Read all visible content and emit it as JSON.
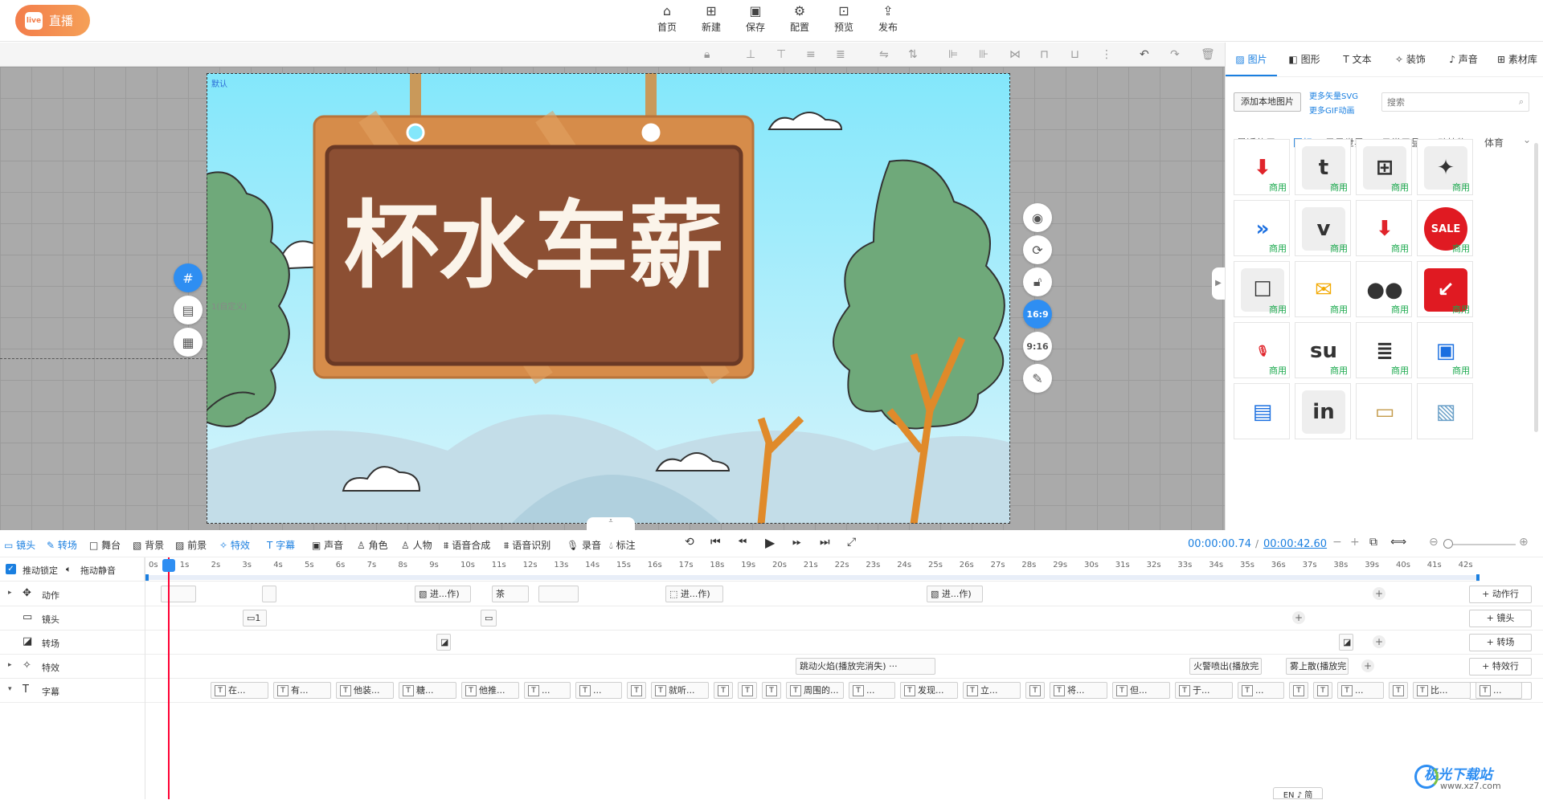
{
  "topbar": {
    "live_label": "直播",
    "live_icon": "live",
    "nav": [
      {
        "label": "首页",
        "icon": "home-icon"
      },
      {
        "label": "新建",
        "icon": "new-icon"
      },
      {
        "label": "保存",
        "icon": "save-icon"
      },
      {
        "label": "配置",
        "icon": "settings-icon"
      },
      {
        "label": "预览",
        "icon": "preview-icon"
      },
      {
        "label": "发布",
        "icon": "publish-icon"
      }
    ]
  },
  "scene": {
    "default_label": "默认",
    "custom_label": "1(自定义)",
    "title_text": "杯水车薪"
  },
  "side_controls": {
    "ratio_169": "16:9",
    "ratio_916": "9:16"
  },
  "right_panel": {
    "tabs": [
      {
        "label": "图片",
        "icon": "image-icon"
      },
      {
        "label": "图形",
        "icon": "shape-icon"
      },
      {
        "label": "文本",
        "icon": "text-icon"
      },
      {
        "label": "装饰",
        "icon": "decor-icon"
      },
      {
        "label": "声音",
        "icon": "sound-icon"
      },
      {
        "label": "素材库",
        "icon": "library-icon"
      }
    ],
    "add_local": "添加本地图片",
    "more_svg": "更多矢量SVG",
    "more_gif": "更多GIF动画",
    "search_placeholder": "搜索",
    "categories": [
      "最近使用",
      "图标",
      "风景世界",
      "日常用品",
      "动植物",
      "体育"
    ],
    "commercial": "商用",
    "tiles": [
      "download-red-icon",
      "tumblr-sketch-icon",
      "windows-sketch-icon",
      "twitter-sketch-icon",
      "fast-forward-icon",
      "vimeo-sketch-icon",
      "download-pin-icon",
      "sale-badge-icon",
      "robot-sketch-icon",
      "email-icon",
      "flickr-icon",
      "sale-arrow-icon",
      "microphone-icon",
      "stumbleupon-sketch-icon",
      "receipt-icon",
      "folder-lock-icon",
      "folders-icon",
      "linkedin-sketch-icon",
      "id-card-icon",
      "picture-icon"
    ]
  },
  "controls": {
    "items": [
      "镜头",
      "转场",
      "舞台",
      "背景",
      "前景",
      "特效",
      "字幕",
      "声音",
      "角色",
      "人物",
      "语音合成",
      "语音识别",
      "录音",
      "标注"
    ],
    "current_time": "00:00:00.74",
    "total_time": "00:00:42.60"
  },
  "timeline": {
    "lock_label": "推动锁定",
    "mute_label": "拖动静音",
    "ticks": [
      "0s",
      "1s",
      "2s",
      "3s",
      "4s",
      "5s",
      "6s",
      "7s",
      "8s",
      "9s",
      "10s",
      "11s",
      "12s",
      "13s",
      "14s",
      "15s",
      "16s",
      "17s",
      "18s",
      "19s",
      "20s",
      "21s",
      "22s",
      "23s",
      "24s",
      "25s",
      "26s",
      "27s",
      "28s",
      "29s",
      "30s",
      "31s",
      "32s",
      "33s",
      "34s",
      "35s",
      "36s",
      "37s",
      "38s",
      "39s",
      "40s",
      "41s",
      "42s"
    ],
    "tracks": [
      {
        "label": "动作",
        "add": "动作行"
      },
      {
        "label": "镜头",
        "add": "镜头"
      },
      {
        "label": "转场",
        "add": "转场"
      },
      {
        "label": "特效",
        "add": "特效行"
      },
      {
        "label": "字幕",
        "add": "字幕行"
      }
    ],
    "action_clips": [
      "进...作)",
      "进...作)",
      "进...作)"
    ],
    "effect_clips": [
      "跳动火焰(播放完消失) ···",
      "火警喷出(播放完",
      "雾上散(播放完"
    ],
    "subtitle_clips": [
      "在...",
      "有...",
      "他装...",
      "糖...",
      "他推...",
      "...",
      "...",
      "",
      "就听...",
      "",
      "",
      "",
      "周围的...",
      "...",
      "发现...",
      "立...",
      "",
      "将...",
      "但...",
      "于...",
      "...",
      "",
      "",
      "...",
      "",
      "比...",
      "..."
    ]
  },
  "watermark": {
    "site": "极光下载站",
    "url": "www.xz7.com"
  },
  "ime": "EN ♪ 简"
}
